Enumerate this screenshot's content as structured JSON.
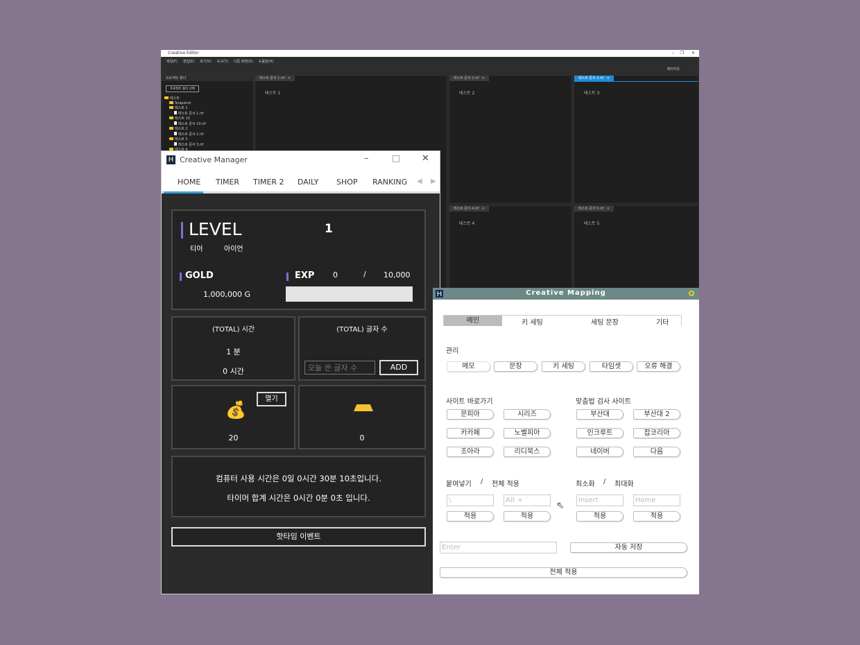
{
  "editor": {
    "title": "Creative Editor",
    "menu": [
      "파일(F)",
      "편집(E)",
      "보기(V)",
      "도구(T)",
      "다중 화면(D)",
      "도움말(H)"
    ],
    "layout_label": "레이아웃",
    "project_panel": {
      "title": "프로젝트 폴더",
      "select_button": "프로젝트 폴더 선택",
      "tree": [
        {
          "label": "테스트",
          "level": 0
        },
        {
          "label": "Snapshot",
          "level": 1
        },
        {
          "label": "테스트 1",
          "level": 1
        },
        {
          "label": "테스트 문서 1.rtf",
          "level": 2,
          "file": true
        },
        {
          "label": "테스트 10",
          "level": 1
        },
        {
          "label": "테스트 문서 10.rtf",
          "level": 2,
          "file": true
        },
        {
          "label": "테스트 2",
          "level": 1
        },
        {
          "label": "테스트 문서 2.rtf",
          "level": 2,
          "file": true
        },
        {
          "label": "테스트 3",
          "level": 1
        },
        {
          "label": "테스트 문서 3.rtf",
          "level": 2,
          "file": true
        },
        {
          "label": "테스트 4",
          "level": 1
        }
      ]
    },
    "documents": [
      {
        "tab": "테스트 문서 1.rtf",
        "text": "테스트 1"
      },
      {
        "tab": "테스트 문서 2.rtf",
        "text": "테스트 2"
      },
      {
        "tab": "테스트 문서 3.rtf",
        "text": "테스트 3",
        "active": true
      },
      {
        "tab": "테스트 문서 4.rtf",
        "text": "테스트 4"
      },
      {
        "tab": "테스트 문서 5.rtf",
        "text": "테스트 5"
      }
    ]
  },
  "manager": {
    "title": "Creative Manager",
    "tabs": [
      "HOME",
      "TIMER",
      "TIMER 2",
      "DAILY",
      "SHOP",
      "RANKING"
    ],
    "active_tab": "HOME",
    "level_label": "LEVEL",
    "level": "1",
    "tier_label": "티어",
    "tier": "아이언",
    "gold_label": "GOLD",
    "gold": "1,000,000 G",
    "exp_label": "EXP",
    "exp": "0",
    "exp_sep": "/",
    "exp_max": "10,000",
    "exp_progress": 0,
    "total_time_label": "(TOTAL) 시간",
    "minutes": "1 분",
    "hours": "0 시간",
    "total_chars_label": "(TOTAL) 글자 수",
    "chars_placeholder": "오늘 쓴 글자 수",
    "add_button": "ADD",
    "bag_open_button": "열기",
    "bag_count": "20",
    "gold_bar_count": "0",
    "usage_line1": "컴퓨터 사용 시간은 0일 0시간 30분 10초입니다.",
    "usage_line2": "타이머 합계 시간은 0시간 0분 0초 입니다.",
    "hottime_button": "핫타임 이벤트",
    "accent": "#7b6ee0",
    "tab_underline": "#3aa0d8"
  },
  "mapping": {
    "title": "Creative Mapping",
    "tabs": [
      "메인",
      "키 세팅",
      "세팅 문장",
      "기타"
    ],
    "active_tab": "메인",
    "manage_label": "관리",
    "manage_buttons": [
      "메모",
      "문장",
      "키 세팅",
      "타임셋",
      "오류 해결"
    ],
    "sites_label": "사이트 바로가기",
    "sites": [
      "문피아",
      "시리즈",
      "카카페",
      "노벨피아",
      "조아라",
      "리디북스"
    ],
    "spell_label": "맞춤법 검사 사이트",
    "spell_sites": [
      "부산대",
      "부산대 2",
      "인크루트",
      "잡코리아",
      "네이버",
      "다음"
    ],
    "paste_label": "붙여넣기",
    "slash": "/",
    "apply_all_label": "전체 적용",
    "min_label": "최소화",
    "max_label": "최대화",
    "keys": [
      "\\",
      "Alt + `",
      "Insert",
      "Home"
    ],
    "apply_button": "적용",
    "enter_value": "Enter",
    "auto_save_button": "자동 저장",
    "apply_all_button": "전체 적용"
  }
}
